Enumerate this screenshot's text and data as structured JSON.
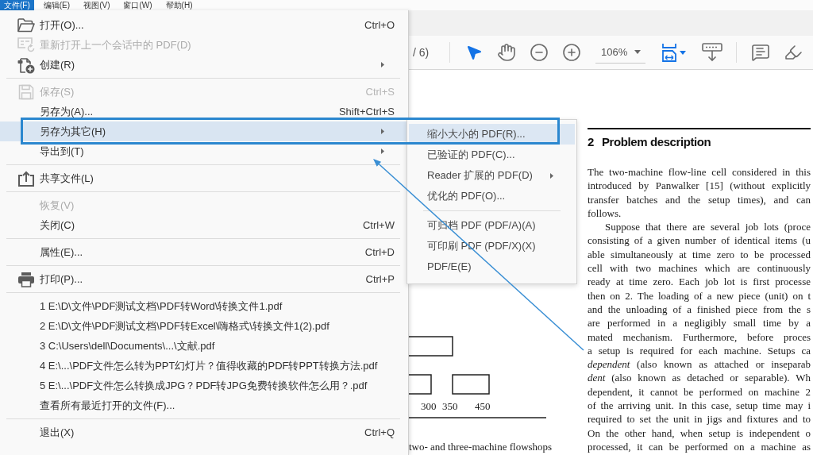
{
  "menubar": {
    "items": [
      {
        "label": "文件(F)",
        "selected": true
      },
      {
        "label": "编辑(E)",
        "selected": false
      },
      {
        "label": "视图(V)",
        "selected": false
      },
      {
        "label": "窗口(W)",
        "selected": false
      },
      {
        "label": "帮助(H)",
        "selected": false
      }
    ]
  },
  "file_menu": {
    "groups": [
      {
        "items": [
          {
            "kind": "open",
            "label": "打开(O)...",
            "shortcut": "Ctrl+O",
            "submenu": false,
            "disabled": false,
            "selected": false
          },
          {
            "kind": "reopen",
            "label": "重新打开上一个会话中的 PDF(D)",
            "submenu": false,
            "disabled": true,
            "selected": false
          },
          {
            "kind": "create",
            "label": "创建(R)",
            "submenu": true,
            "disabled": false,
            "selected": false
          }
        ]
      },
      {
        "items": [
          {
            "kind": "save",
            "label": "保存(S)",
            "shortcut": "Ctrl+S",
            "submenu": false,
            "disabled": true,
            "selected": false
          },
          {
            "kind": "plain",
            "label": "另存为(A)...",
            "shortcut": "Shift+Ctrl+S",
            "submenu": false,
            "disabled": false,
            "selected": false
          },
          {
            "kind": "plain",
            "label": "另存为其它(H)",
            "submenu": true,
            "disabled": false,
            "selected": true
          },
          {
            "kind": "plain",
            "label": "导出到(T)",
            "submenu": true,
            "disabled": false,
            "selected": false
          }
        ]
      },
      {
        "items": [
          {
            "kind": "share",
            "label": "共享文件(L)",
            "submenu": false,
            "disabled": false,
            "selected": false
          }
        ]
      },
      {
        "items": [
          {
            "kind": "plain",
            "label": "恢复(V)",
            "submenu": false,
            "disabled": true,
            "selected": false
          },
          {
            "kind": "plain",
            "label": "关闭(C)",
            "shortcut": "Ctrl+W",
            "submenu": false,
            "disabled": false,
            "selected": false
          }
        ]
      },
      {
        "items": [
          {
            "kind": "plain",
            "label": "属性(E)...",
            "shortcut": "Ctrl+D",
            "submenu": false,
            "disabled": false,
            "selected": false
          }
        ]
      },
      {
        "items": [
          {
            "kind": "print",
            "label": "打印(P)...",
            "shortcut": "Ctrl+P",
            "submenu": false,
            "disabled": false,
            "selected": false
          }
        ]
      },
      {
        "items": [
          {
            "kind": "plain",
            "label": "1 E:\\D\\文件\\PDF测试文档\\PDF转Word\\转换文件1.pdf",
            "submenu": false,
            "disabled": false,
            "selected": false
          },
          {
            "kind": "plain",
            "label": "2 E:\\D\\文件\\PDF测试文档\\PDF转Excel\\嗨格式\\转换文件1(2).pdf",
            "submenu": false,
            "disabled": false,
            "selected": false
          },
          {
            "kind": "plain",
            "label": "3 C:\\Users\\dell\\Documents\\...\\文献.pdf",
            "submenu": false,
            "disabled": false,
            "selected": false
          },
          {
            "kind": "plain",
            "label": "4 E:\\...\\PDF文件怎么转为PPT幻灯片？值得收藏的PDF转PPT转换方法.pdf",
            "submenu": false,
            "disabled": false,
            "selected": false
          },
          {
            "kind": "plain",
            "label": "5 E:\\...\\PDF文件怎么转换成JPG？PDF转JPG免费转换软件怎么用？.pdf",
            "submenu": false,
            "disabled": false,
            "selected": false
          },
          {
            "kind": "plain",
            "label": "查看所有最近打开的文件(F)...",
            "submenu": false,
            "disabled": false,
            "selected": false
          }
        ]
      },
      {
        "items": [
          {
            "kind": "plain",
            "label": "退出(X)",
            "shortcut": "Ctrl+Q",
            "submenu": false,
            "disabled": false,
            "selected": false
          }
        ]
      }
    ]
  },
  "save_as_other_submenu": {
    "groups": [
      {
        "items": [
          {
            "label": "缩小大小的 PDF(R)...",
            "submenu": false,
            "selected": true
          },
          {
            "label": "已验证的 PDF(C)...",
            "submenu": false,
            "selected": false
          },
          {
            "label": "Reader 扩展的 PDF(D)",
            "submenu": true,
            "selected": false
          },
          {
            "label": "优化的 PDF(O)...",
            "submenu": false,
            "selected": false
          }
        ]
      },
      {
        "items": [
          {
            "label": "可归档 PDF (PDF/A)(A)",
            "submenu": false,
            "selected": false
          },
          {
            "label": "可印刷 PDF (PDF/X)(X)",
            "submenu": false,
            "selected": false
          },
          {
            "label": "PDF/E(E)",
            "submenu": false,
            "selected": false
          }
        ]
      }
    ]
  },
  "toolbar": {
    "page_count": "/ 6)",
    "navigation_tools": [
      {
        "kind": "select",
        "selected": true
      },
      {
        "kind": "hand",
        "selected": false
      },
      {
        "kind": "zoom_out",
        "selected": false
      },
      {
        "kind": "zoom_in",
        "selected": false
      }
    ],
    "zoom": {
      "value": "106%"
    },
    "view_tools": [
      {
        "kind": "fit_page",
        "selected": true,
        "dropdown": true
      },
      {
        "kind": "scroll_mode",
        "selected": false,
        "dropdown": false
      }
    ],
    "annotation_tools": [
      {
        "kind": "comment",
        "selected": false
      },
      {
        "kind": "highlight",
        "selected": false
      }
    ]
  },
  "document": {
    "left_column": {
      "figure": {
        "tick_labels": [
          "300",
          "350",
          "450"
        ]
      },
      "text": "two- and three-machine flowshops"
    },
    "section": {
      "number": "2",
      "title": "Problem description",
      "paragraphs": [
        {
          "indent": false,
          "lines": [
            "The two-machine flow-line cell considered in this",
            "introduced by Panwalker [15] (without explicitly",
            "transfer batches and the setup times), and can",
            "follows."
          ]
        },
        {
          "indent": true,
          "lines": [
            "Suppose that there are several job lots (proce",
            "consisting of a given number of identical items (u",
            "able simultaneously at time zero to be processed",
            "cell with two machines which are continuously",
            "ready at time zero. Each job lot is first processe",
            "then on 2. The loading of a new piece (unit) on t",
            "and the unloading of a finished piece from the s",
            "are performed in a negligibly small time by a",
            "mated mechanism. Furthermore, before proces",
            "a setup is required for each machine. Setups ca",
            "*dependent* (also known as attached or inseparab",
            "*dent* (also known as detached or separable). Wh",
            "dependent, it cannot be performed on machine 2",
            "of the arriving unit. In this case, setup time may i",
            "required to set the unit in jigs and fixtures and to",
            "On the other hand, when setup is independent o",
            "processed, it can be performed on a machine as"
          ]
        }
      ]
    }
  }
}
